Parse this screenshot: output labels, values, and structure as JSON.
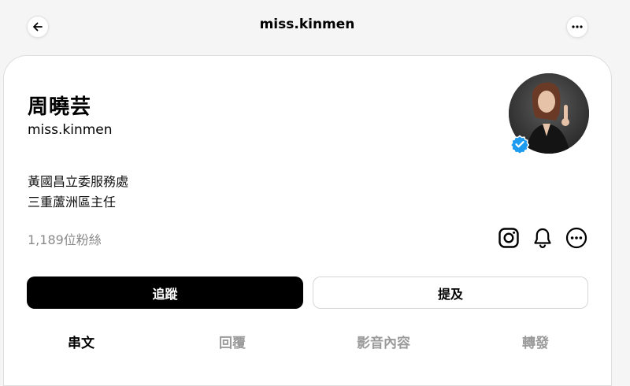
{
  "header": {
    "title": "miss.kinmen",
    "back_icon": "arrow-left-icon",
    "more_icon": "ellipsis-icon"
  },
  "profile": {
    "display_name": "周曉芸",
    "username": "miss.kinmen",
    "verified": true,
    "bio_lines": [
      "黃國昌立委服務處",
      "三重蘆洲區主任"
    ],
    "followers": "1,189位粉絲"
  },
  "actions": {
    "follow_label": "追蹤",
    "mention_label": "提及"
  },
  "tabs": [
    {
      "label": "串文",
      "active": true
    },
    {
      "label": "回覆",
      "active": false
    },
    {
      "label": "影音內容",
      "active": false
    },
    {
      "label": "轉發",
      "active": false
    }
  ],
  "icons": [
    "instagram-icon",
    "bell-icon",
    "ellipsis-circle-icon"
  ],
  "colors": {
    "background": "#f5f5f5",
    "card": "#ffffff",
    "primary_button": "#000000",
    "verified_badge": "#1d9bf0",
    "muted_text": "#8a8a8a"
  }
}
